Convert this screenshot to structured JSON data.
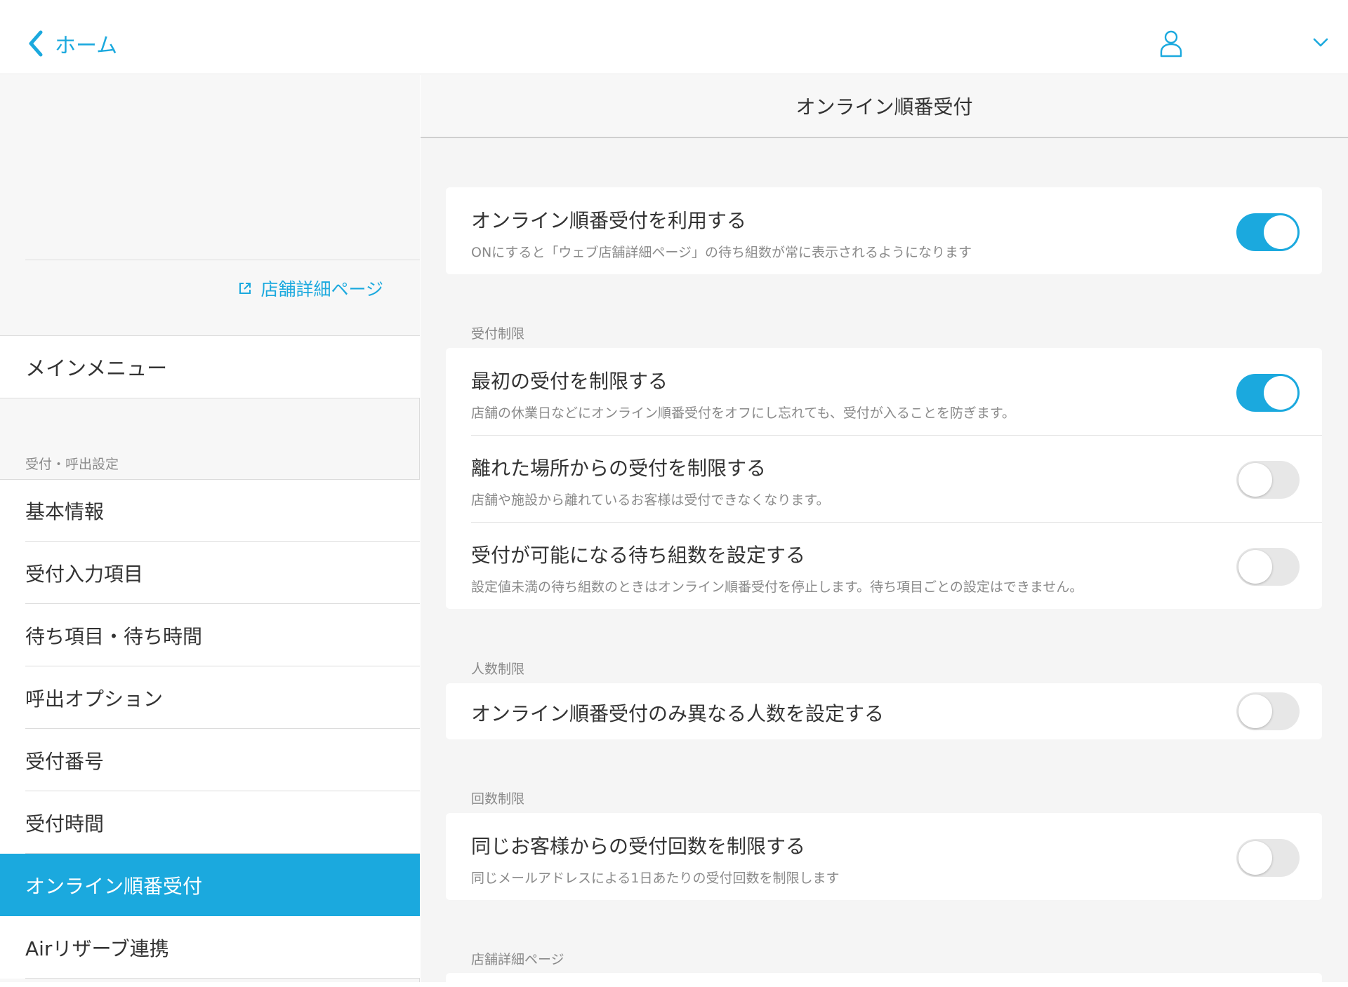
{
  "colors": {
    "accent": "#1ba9de",
    "background": "#f5f5f5"
  },
  "topbar": {
    "back_label": "ホーム",
    "user_icon": "user-icon",
    "menu_icon": "chevron-down-icon"
  },
  "sidebar": {
    "store_link": "店舗詳細ページ",
    "main_menu": "メインメニュー",
    "section_label": "受付・呼出設定",
    "items": [
      {
        "label": "基本情報",
        "active": false
      },
      {
        "label": "受付入力項目",
        "active": false
      },
      {
        "label": "待ち項目・待ち時間",
        "active": false
      },
      {
        "label": "呼出オプション",
        "active": false
      },
      {
        "label": "受付番号",
        "active": false
      },
      {
        "label": "受付時間",
        "active": false
      },
      {
        "label": "オンライン順番受付",
        "active": true
      },
      {
        "label": "Airリザーブ連携",
        "active": false
      }
    ]
  },
  "main": {
    "title": "オンライン順番受付",
    "use_setting": {
      "title": "オンライン順番受付を利用する",
      "description": "ONにすると「ウェブ店舗詳細ページ」の待ち組数が常に表示されるようになります",
      "on": true
    },
    "reception_limit": {
      "label": "受付制限",
      "rows": [
        {
          "title": "最初の受付を制限する",
          "description": "店舗の休業日などにオンライン順番受付をオフにし忘れても、受付が入ることを防ぎます。",
          "on": true
        },
        {
          "title": "離れた場所からの受付を制限する",
          "description": "店舗や施設から離れているお客様は受付できなくなります。",
          "on": false
        },
        {
          "title": "受付が可能になる待ち組数を設定する",
          "description": "設定値未満の待ち組数のときはオンライン順番受付を停止します。待ち項目ごとの設定はできません。",
          "on": false
        }
      ]
    },
    "people_limit": {
      "label": "人数制限",
      "rows": [
        {
          "title": "オンライン順番受付のみ異なる人数を設定する",
          "on": false
        }
      ]
    },
    "count_limit": {
      "label": "回数制限",
      "rows": [
        {
          "title": "同じお客様からの受付回数を制限する",
          "description": "同じメールアドレスによる1日あたりの受付回数を制限します",
          "on": false
        }
      ]
    },
    "store_page_label": "店舗詳細ページ"
  }
}
